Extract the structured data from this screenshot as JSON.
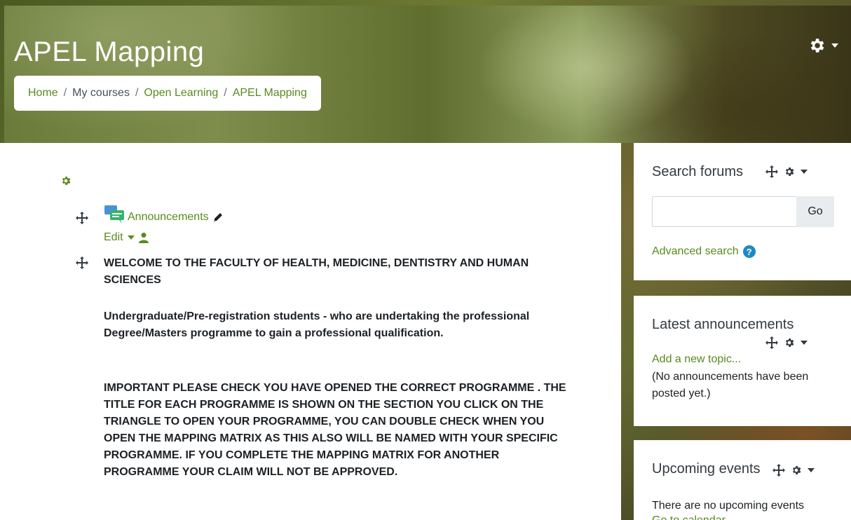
{
  "header": {
    "title": "APEL Mapping",
    "breadcrumb": [
      "Home",
      "My courses",
      "Open Learning",
      "APEL Mapping"
    ],
    "breadcrumb_sep": "/"
  },
  "main": {
    "announcements_label": "Announcements",
    "edit_label": "Edit",
    "welcome_heading": "WELCOME TO THE FACULTY OF HEALTH, MEDICINE, DENTISTRY AND HUMAN SCIENCES",
    "undergrad_text": "Undergraduate/Pre-registration students - who are undertaking the professional Degree/Masters programme to gain a professional qualification.",
    "important_text": "IMPORTANT PLEASE CHECK YOU HAVE OPENED THE  CORRECT PROGRAMME .  THE TITLE FOR EACH PROGRAMME IS SHOWN ON THE SECTION YOU CLICK ON THE TRIANGLE TO OPEN YOUR PROGRAMME, YOU CAN DOUBLE CHECK WHEN YOU OPEN THE MAPPING MATRIX AS THIS ALSO WILL BE NAMED WITH YOUR SPECIFIC PROGRAMME. IF YOU COMPLETE THE MAPPING MATRIX FOR ANOTHER PROGRAMME YOUR CLAIM WILL NOT BE APPROVED."
  },
  "sidebar": {
    "search_forums": {
      "title": "Search forums",
      "go_label": "Go",
      "advanced_search": "Advanced search",
      "help_glyph": "?"
    },
    "latest_announcements": {
      "title": "Latest announcements",
      "add_topic": "Add a new topic...",
      "empty_text": "(No announcements have been posted yet.)"
    },
    "upcoming_events": {
      "title": "Upcoming events",
      "empty_text": "There are no upcoming events",
      "go_to_calendar": "Go to calendar..."
    }
  },
  "colors": {
    "link": "#5a8a1e",
    "gear_green": "#5a8a1e",
    "help_blue": "#1e88c7"
  }
}
